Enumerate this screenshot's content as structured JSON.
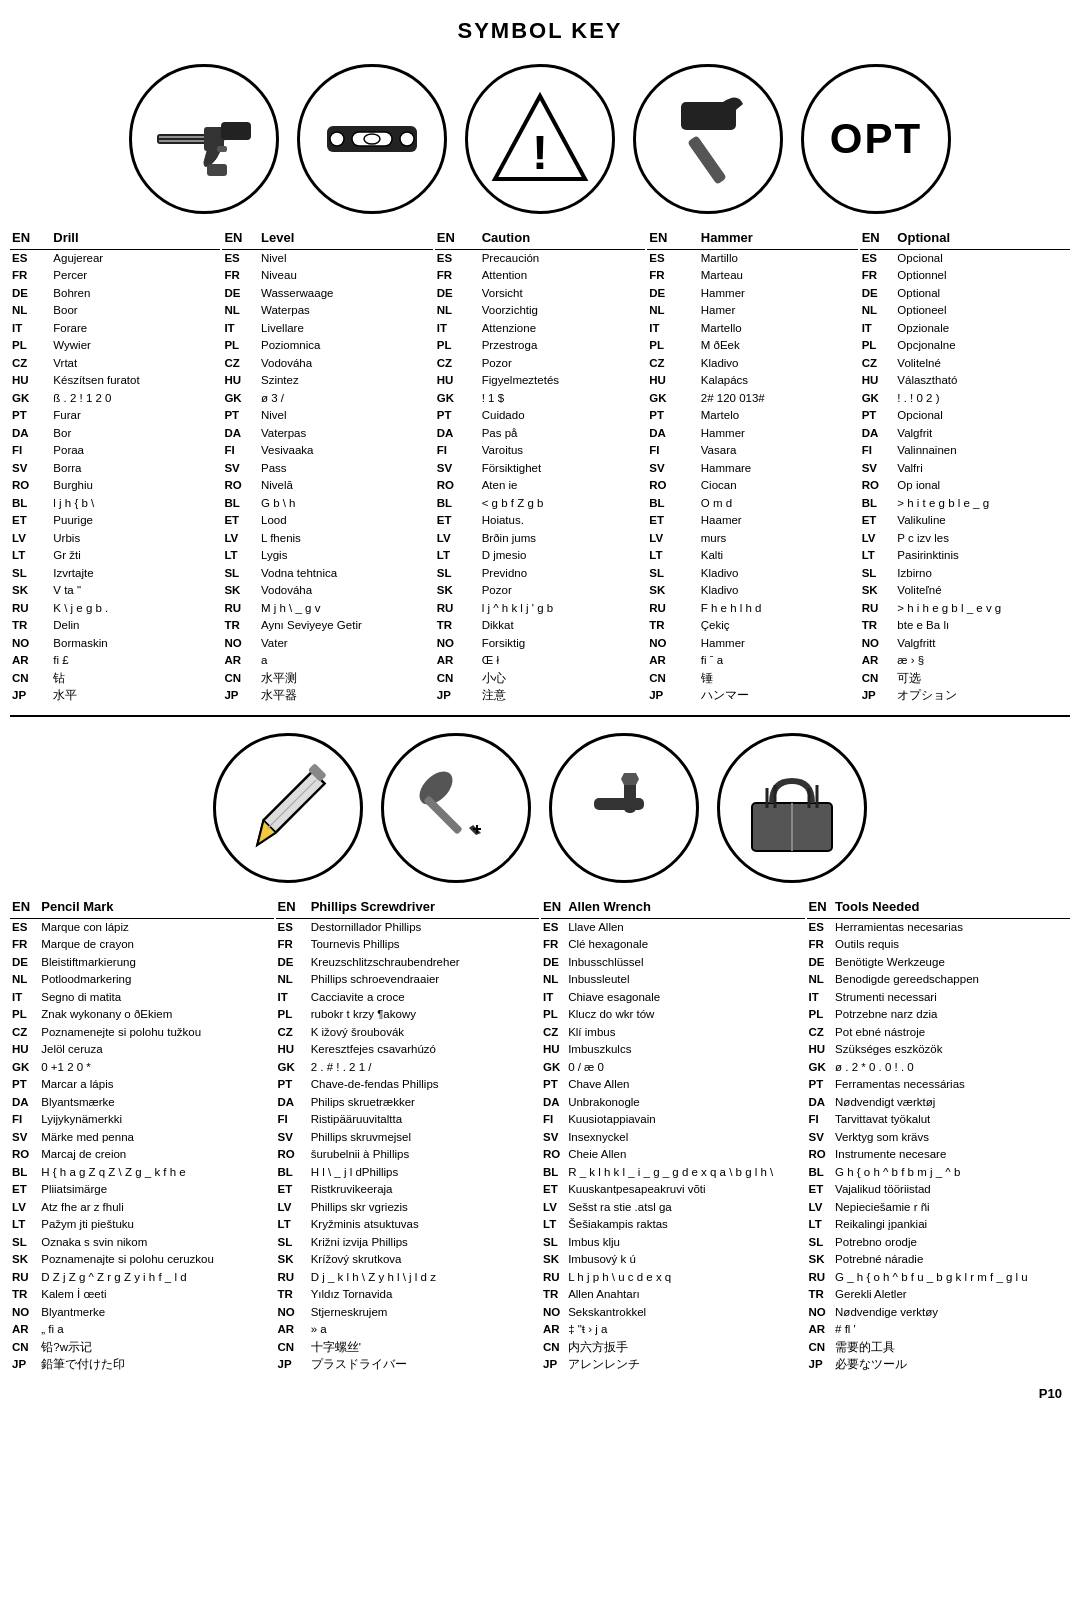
{
  "title": "SYMBOL KEY",
  "page_number": "P10",
  "symbols_top": [
    {
      "id": "drill",
      "label": "Drill"
    },
    {
      "id": "level",
      "label": "Level"
    },
    {
      "id": "caution",
      "label": "Caution"
    },
    {
      "id": "hammer",
      "label": "Hammer"
    },
    {
      "id": "optional",
      "label": "OPT"
    }
  ],
  "symbols_bottom": [
    {
      "id": "pencil",
      "label": "Pencil Mark"
    },
    {
      "id": "phillips",
      "label": "Phillips Screwdriver"
    },
    {
      "id": "allen",
      "label": "Allen Wrench"
    },
    {
      "id": "toolbox",
      "label": "Tools Needed"
    }
  ],
  "tables_top": [
    {
      "id": "drill",
      "rows": [
        [
          "EN",
          "Drill"
        ],
        [
          "ES",
          "Agujerear"
        ],
        [
          "FR",
          "Percer"
        ],
        [
          "DE",
          "Bohren"
        ],
        [
          "NL",
          "Boor"
        ],
        [
          "IT",
          "Forare"
        ],
        [
          "PL",
          "Wywier"
        ],
        [
          "CZ",
          "Vrtat"
        ],
        [
          "HU",
          "Készítsen furatot"
        ],
        [
          "GK",
          "ß . 2 ! 1 2 0"
        ],
        [
          "PT",
          "Furar"
        ],
        [
          "DA",
          "Bor"
        ],
        [
          "FI",
          "Poraa"
        ],
        [
          "SV",
          "Borra"
        ],
        [
          "RO",
          "Burghiu"
        ],
        [
          "BL",
          "l j h { b \\"
        ],
        [
          "ET",
          "Puurige"
        ],
        [
          "LV",
          "Urbis"
        ],
        [
          "LT",
          "Gr žti"
        ],
        [
          "SL",
          "Izvrtajte"
        ],
        [
          "SK",
          "V ta \""
        ],
        [
          "RU",
          "K \\ j e  g b ."
        ],
        [
          "TR",
          "Delin"
        ],
        [
          "NO",
          "Bormaskin"
        ],
        [
          "AR",
          "fi £"
        ],
        [
          "CN",
          "钻"
        ],
        [
          "JP",
          "水平"
        ]
      ]
    },
    {
      "id": "level",
      "rows": [
        [
          "EN",
          "Level"
        ],
        [
          "ES",
          "Nivel"
        ],
        [
          "FR",
          "Niveau"
        ],
        [
          "DE",
          "Wasserwaage"
        ],
        [
          "NL",
          "Waterpas"
        ],
        [
          "IT",
          "Livellare"
        ],
        [
          "PL",
          "Poziomnica"
        ],
        [
          "CZ",
          "Vodováha"
        ],
        [
          "HU",
          "Szintez"
        ],
        [
          "GK",
          "ø 3  /"
        ],
        [
          "PT",
          "Nivel"
        ],
        [
          "DA",
          "Vaterpas"
        ],
        [
          "FI",
          "Vesivaaka"
        ],
        [
          "SV",
          "Pass"
        ],
        [
          "RO",
          "Nivelă"
        ],
        [
          "BL",
          "G b \\ h"
        ],
        [
          "ET",
          "Lood"
        ],
        [
          "LV",
          "L fhenis"
        ],
        [
          "LT",
          "Lygis"
        ],
        [
          "SL",
          "Vodna tehtnica"
        ],
        [
          "SK",
          "Vodováha"
        ],
        [
          "RU",
          "M j h \\ _ g v"
        ],
        [
          "TR",
          "Aynı Seviyeye Getir"
        ],
        [
          "NO",
          "Vater"
        ],
        [
          "AR",
          "a"
        ],
        [
          "CN",
          "水平测"
        ],
        [
          "JP",
          "水平器"
        ]
      ]
    },
    {
      "id": "caution",
      "rows": [
        [
          "EN",
          "Caution"
        ],
        [
          "ES",
          "Precaución"
        ],
        [
          "FR",
          "Attention"
        ],
        [
          "DE",
          "Vorsicht"
        ],
        [
          "NL",
          "Voorzichtig"
        ],
        [
          "IT",
          "Attenzione"
        ],
        [
          "PL",
          "Przestroga"
        ],
        [
          "CZ",
          "Pozor"
        ],
        [
          "HU",
          "Figyelmeztetés"
        ],
        [
          "GK",
          "! 1  $"
        ],
        [
          "PT",
          "Cuidado"
        ],
        [
          "DA",
          "Pas på"
        ],
        [
          "FI",
          "Varoitus"
        ],
        [
          "SV",
          "Försiktighet"
        ],
        [
          "RO",
          "Aten ie"
        ],
        [
          "BL",
          "< g b f Z g b"
        ],
        [
          "ET",
          "Hoiatus."
        ],
        [
          "LV",
          "Brðin jums"
        ],
        [
          "LT",
          "D jmesio"
        ],
        [
          "SL",
          "Previdno"
        ],
        [
          "SK",
          "Pozor"
        ],
        [
          "RU",
          "l j  ^ h k l  j ' g b"
        ],
        [
          "TR",
          "Dikkat"
        ],
        [
          "NO",
          "Forsiktig"
        ],
        [
          "AR",
          "Œ  ł"
        ],
        [
          "CN",
          "小心"
        ],
        [
          "JP",
          "注意"
        ]
      ]
    },
    {
      "id": "hammer",
      "rows": [
        [
          "EN",
          "Hammer"
        ],
        [
          "ES",
          "Martillo"
        ],
        [
          "FR",
          "Marteau"
        ],
        [
          "DE",
          "Hammer"
        ],
        [
          "NL",
          "Hamer"
        ],
        [
          "IT",
          "Martello"
        ],
        [
          "PL",
          "M ðEek"
        ],
        [
          "CZ",
          "Kladivo"
        ],
        [
          "HU",
          "Kalapács"
        ],
        [
          "GK",
          "2#  120  013#"
        ],
        [
          "PT",
          "Martelo"
        ],
        [
          "DA",
          "Hammer"
        ],
        [
          "FI",
          "Vasara"
        ],
        [
          "SV",
          "Hammare"
        ],
        [
          "RO",
          "Ciocan"
        ],
        [
          "BL",
          "O m d"
        ],
        [
          "ET",
          "Haamer"
        ],
        [
          "LV",
          "murs"
        ],
        [
          "LT",
          "Kalti"
        ],
        [
          "SL",
          "Kladivo"
        ],
        [
          "SK",
          "Kladivo"
        ],
        [
          "RU",
          "F h e h l h d"
        ],
        [
          "TR",
          "Çekiç"
        ],
        [
          "NO",
          "Hammer"
        ],
        [
          "AR",
          "fi ˉ a"
        ],
        [
          "CN",
          "锤"
        ],
        [
          "JP",
          "ハンマー"
        ]
      ]
    },
    {
      "id": "optional",
      "rows": [
        [
          "EN",
          "Optional"
        ],
        [
          "ES",
          "Opcional"
        ],
        [
          "FR",
          "Optionnel"
        ],
        [
          "DE",
          "Optional"
        ],
        [
          "NL",
          "Optioneel"
        ],
        [
          "IT",
          "Opzionale"
        ],
        [
          "PL",
          "Opcjonalne"
        ],
        [
          "CZ",
          "Volitelné"
        ],
        [
          "HU",
          "Választható"
        ],
        [
          "GK",
          "! . ! 0 2  )"
        ],
        [
          "PT",
          "Opcional"
        ],
        [
          "DA",
          "Valgfrit"
        ],
        [
          "FI",
          "Valinnainen"
        ],
        [
          "SV",
          "Valfri"
        ],
        [
          "RO",
          "Op ional"
        ],
        [
          "BL",
          "> h i t e g b l  e _ g"
        ],
        [
          "ET",
          "Valikuline"
        ],
        [
          "LV",
          "P c izv les"
        ],
        [
          "LT",
          "Pasirinktinis"
        ],
        [
          "SL",
          "Izbirno"
        ],
        [
          "SK",
          "Voliteľné"
        ],
        [
          "RU",
          "> h i h e g b l _ e v g"
        ],
        [
          "TR",
          "bte  e Ba lı"
        ],
        [
          "NO",
          "Valgfritt"
        ],
        [
          "AR",
          "æ ›   §"
        ],
        [
          "CN",
          "可选"
        ],
        [
          "JP",
          "オプション"
        ]
      ]
    }
  ],
  "tables_bottom": [
    {
      "id": "pencil",
      "rows": [
        [
          "EN",
          "Pencil Mark"
        ],
        [
          "ES",
          "Marque con lápiz"
        ],
        [
          "FR",
          "Marque de crayon"
        ],
        [
          "DE",
          "Bleistiftmarkierung"
        ],
        [
          "NL",
          "Potloodmarkering"
        ],
        [
          "IT",
          "Segno di matita"
        ],
        [
          "PL",
          "Znak wykonany o ðEkiem"
        ],
        [
          "CZ",
          "Poznamenejte si polohu tužkou"
        ],
        [
          "HU",
          "Jelöl  ceruza"
        ],
        [
          "GK",
          "0  +1 2 0    *"
        ],
        [
          "PT",
          "Marcar a lápis"
        ],
        [
          "DA",
          "Blyantsmærke"
        ],
        [
          "FI",
          "Lyijykynämerkki"
        ],
        [
          "SV",
          "Märke med penna"
        ],
        [
          "RO",
          "Marcaj de creion"
        ],
        [
          "BL",
          "H { h a g Z q Z \\ Z g _ k f h e"
        ],
        [
          "ET",
          "Pliiatsimärge"
        ],
        [
          "LV",
          "Atz fhe ar z fhuli"
        ],
        [
          "LT",
          "Pažym jti pieštuku"
        ],
        [
          "SL",
          "Oznaka s svin nikom"
        ],
        [
          "SK",
          "Poznamenajte si polohu ceruzkou"
        ],
        [
          "RU",
          "D Z j Z g ^ Z r g Z y i h f _ l d"
        ],
        [
          "TR",
          "Kalem İ œeti"
        ],
        [
          "NO",
          "Blyantmerke"
        ],
        [
          "AR",
          "„  fi   a"
        ],
        [
          "CN",
          "铅?w示记"
        ],
        [
          "JP",
          "鉛筆で付けた印"
        ]
      ]
    },
    {
      "id": "phillips",
      "rows": [
        [
          "EN",
          "Phillips Screwdriver"
        ],
        [
          "ES",
          "Destornillador Phillips"
        ],
        [
          "FR",
          "Tournevis Phillips"
        ],
        [
          "DE",
          "Kreuzschlitzschraubendreher"
        ],
        [
          "NL",
          "Phillips schroevendraaier"
        ],
        [
          "IT",
          "Cacciavite a croce"
        ],
        [
          "PL",
          "rubokr  t krzy  ¶akowy"
        ],
        [
          "CZ",
          "K ižový šroubovák"
        ],
        [
          "HU",
          "Keresztfejes csavarhúzó"
        ],
        [
          "GK",
          "2 . # !   . 2 1   /"
        ],
        [
          "PT",
          "Chave-de-fendas Phillips"
        ],
        [
          "DA",
          "Philips skruetrækker"
        ],
        [
          "FI",
          "Ristipääruuvitaltta"
        ],
        [
          "SV",
          "Phillips skruvmejsel"
        ],
        [
          "RO",
          "šurubelnii à Phillips"
        ],
        [
          "BL",
          "H l \\ _ j l dPhillips"
        ],
        [
          "ET",
          "Ristkruvikeeraja"
        ],
        [
          "LV",
          "Phillips skr vgriezis"
        ],
        [
          "LT",
          "Kryžminis atsuktuvas"
        ],
        [
          "SL",
          "Križni izvija  Phillips"
        ],
        [
          "SK",
          "Krížový skrutkova"
        ],
        [
          "RU",
          "D j _ k l h \\ Z y h l \\ j l d z"
        ],
        [
          "TR",
          "Yıldız Tornavida"
        ],
        [
          "NO",
          "Stjerneskrujem"
        ],
        [
          "AR",
          "» a"
        ],
        [
          "CN",
          "十字螺丝'"
        ],
        [
          "JP",
          "プラスドライバー"
        ]
      ]
    },
    {
      "id": "allen",
      "rows": [
        [
          "EN",
          "Allen Wrench"
        ],
        [
          "ES",
          "Llave Allen"
        ],
        [
          "FR",
          "Clé hexagonale"
        ],
        [
          "DE",
          "Inbusschlüssel"
        ],
        [
          "NL",
          "Inbussleutel"
        ],
        [
          "IT",
          "Chiave esagonale"
        ],
        [
          "PL",
          "Klucz do wkr  tów"
        ],
        [
          "CZ",
          "Klí imbus"
        ],
        [
          "HU",
          "Imbuszkulcs"
        ],
        [
          "GK",
          "0  /  æ 0"
        ],
        [
          "PT",
          "Chave Allen"
        ],
        [
          "DA",
          "Unbrakonogle"
        ],
        [
          "FI",
          "Kuusiotappiavain"
        ],
        [
          "SV",
          "Insexnyckel"
        ],
        [
          "RO",
          "Cheie Allen"
        ],
        [
          "BL",
          "R _ k l h k l _ i _ g _ g d e x q a \\ b g l h \\"
        ],
        [
          "ET",
          "Kuuskantpesapeakruvi võti"
        ],
        [
          "LV",
          "Sešst ra stie .atsl  ga"
        ],
        [
          "LT",
          "Šešiakampis raktas"
        ],
        [
          "SL",
          "Imbus klju"
        ],
        [
          "SK",
          "Imbusový k ú"
        ],
        [
          "RU",
          "L h j p h \\ u c d e x q"
        ],
        [
          "TR",
          "Allen Anahtarı"
        ],
        [
          "NO",
          "Sekskantrokkel"
        ],
        [
          "AR",
          "‡  \"ŧ › j   a"
        ],
        [
          "CN",
          "内六方扳手"
        ],
        [
          "JP",
          "アレンレンチ"
        ]
      ]
    },
    {
      "id": "toolbox",
      "rows": [
        [
          "EN",
          "Tools Needed"
        ],
        [
          "ES",
          "Herramientas necesarias"
        ],
        [
          "FR",
          "Outils requis"
        ],
        [
          "DE",
          "Benötigte Werkzeuge"
        ],
        [
          "NL",
          "Benodigde gereedschappen"
        ],
        [
          "IT",
          "Strumenti necessari"
        ],
        [
          "PL",
          "Potrzebne narz  dzia"
        ],
        [
          "CZ",
          "Pot ebné nástroje"
        ],
        [
          "HU",
          "Szükséges eszközök"
        ],
        [
          "GK",
          "ø  . 2 * 0 . 0 !  . 0"
        ],
        [
          "PT",
          "Ferramentas necessárias"
        ],
        [
          "DA",
          "Nødvendigt værktøj"
        ],
        [
          "FI",
          "Tarvittavat työkalut"
        ],
        [
          "SV",
          "Verktyg som krävs"
        ],
        [
          "RO",
          "Instrumente necesare"
        ],
        [
          "BL",
          "G  h { o h ^ b f b m j _ ^ b"
        ],
        [
          "ET",
          "Vajalikud tööriistad"
        ],
        [
          "LV",
          "Nepieciešamie r ñi"
        ],
        [
          "LT",
          "Reikalingi įpankiai"
        ],
        [
          "SL",
          "Potrebno orodje"
        ],
        [
          "SK",
          "Potrebné náradie"
        ],
        [
          "RU",
          "G _ h { o h ^ b f u _ b g k l r m f _ g l u"
        ],
        [
          "TR",
          "Gerekli Aletler"
        ],
        [
          "NO",
          "Nødvendige verktøy"
        ],
        [
          "AR",
          "# fl    '"
        ],
        [
          "CN",
          "需要的工具"
        ],
        [
          "JP",
          "必要なツール"
        ]
      ]
    }
  ]
}
